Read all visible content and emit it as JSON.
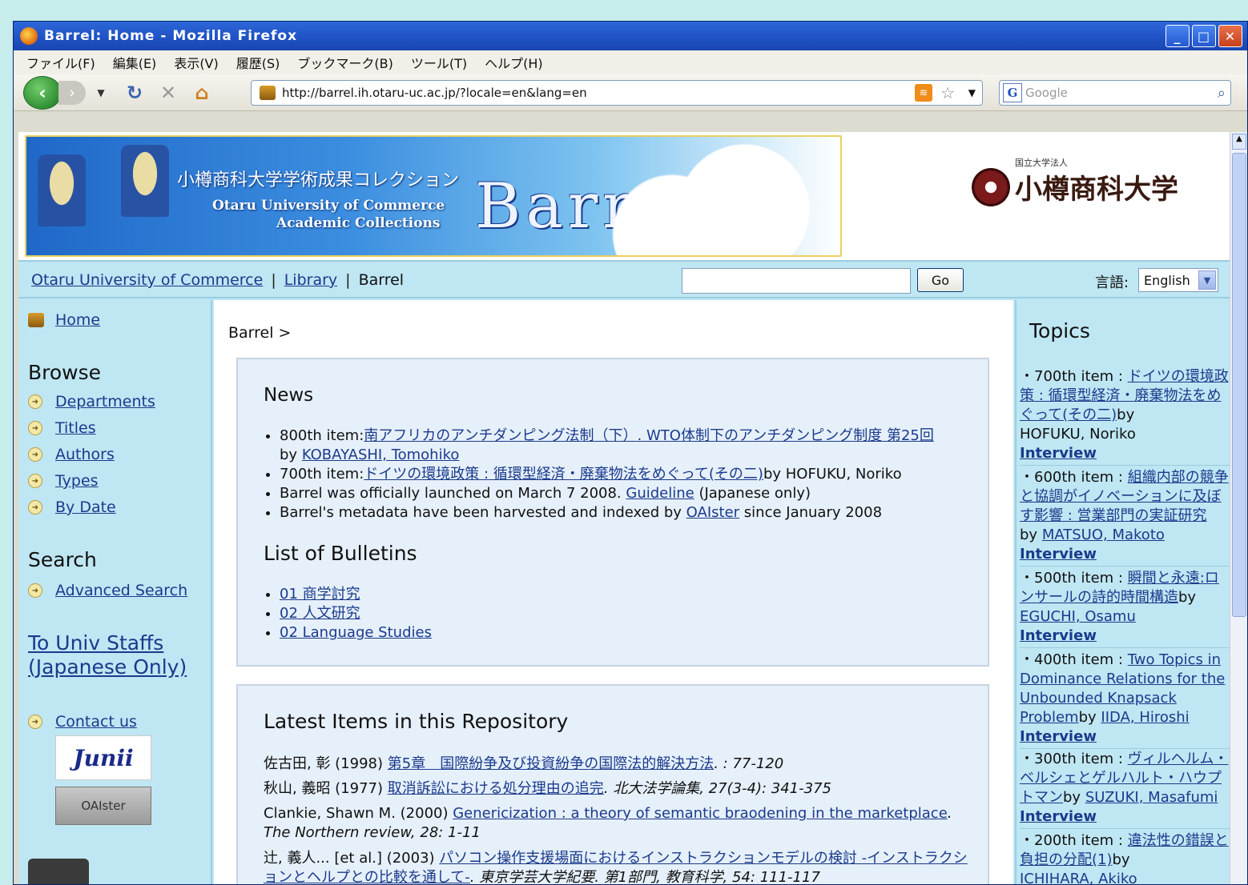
{
  "window": {
    "title": "Barrel: Home - Mozilla Firefox"
  },
  "menu": [
    "ファイル(F)",
    "編集(E)",
    "表示(V)",
    "履歴(S)",
    "ブックマーク(B)",
    "ツール(T)",
    "ヘルプ(H)"
  ],
  "nav": {
    "url": "http://barrel.ih.otaru-uc.ac.jp/?locale=en&lang=en",
    "search_placeholder": "Google"
  },
  "banner": {
    "jp_title": "小樽商科大学学術成果コレクション",
    "en_line1": "Otaru University of Commerce",
    "en_line2": "Academic Collections",
    "logo_text": "Barrel",
    "univ_small": "国立大学法人",
    "univ_name": "小樽商科大学"
  },
  "topbar": {
    "link1": "Otaru University of Commerce",
    "link2": "Library",
    "current": "Barrel",
    "sep": "|",
    "go_label": "Go",
    "lang_label": "言語:",
    "lang_value": "English"
  },
  "left": {
    "home": "Home",
    "browse_heading": "Browse",
    "browse_items": [
      "Departments",
      "Titles",
      "Authors",
      "Types",
      "By Date"
    ],
    "search_heading": "Search",
    "advanced_search": "Advanced Search",
    "staff_link_line1": "To Univ Staffs",
    "staff_link_line2": "(Japanese Only)",
    "contact": "Contact us",
    "junii_label": "Junii",
    "oaister_label": "OAIster"
  },
  "center": {
    "breadcrumb": "Barrel >",
    "news_heading": "News",
    "news": [
      {
        "prefix": "800th item:",
        "link": "南アフリカのアンチダンピング法制（下）. WTO体制下のアンチダンピング制度 第25回",
        "by": "by ",
        "author": "KOBAYASHI, Tomohiko"
      },
      {
        "prefix": "700th item:",
        "link": "ドイツの環境政策 : 循環型経済・廃棄物法をめぐって(その二)",
        "suffix": "by HOFUKU, Noriko"
      },
      {
        "prefix": "Barrel was officially launched on March 7 2008. ",
        "link": "Guideline",
        "suffix": " (Japanese only)"
      },
      {
        "prefix": "Barrel's metadata have been harvested and indexed by ",
        "link": "OAIster",
        "suffix": " since January 2008"
      }
    ],
    "bulletins_heading": "List of Bulletins",
    "bulletins": [
      "01 商学討究",
      "02 人文研究",
      "02 Language Studies"
    ],
    "latest_heading": "Latest Items in this Repository",
    "latest": [
      {
        "author": "佐古田, 彰 (1998) ",
        "title": "第5章　国際紛争及び投資紛争の国際法的解決方法",
        "source": ". : 77-120"
      },
      {
        "author": "秋山, 義昭 (1977) ",
        "title": "取消訴訟における処分理由の追完",
        "source": ". 北大法学論集, 27(3-4): 341-375"
      },
      {
        "author": "Clankie, Shawn M. (2000) ",
        "title": "Genericization : a theory of semantic braodening in the marketplace",
        "source": ". The Northern review, 28: 1-11"
      },
      {
        "author": "辻, 義人... [et al.] (2003) ",
        "title": "パソコン操作支援場面におけるインストラクションモデルの検討 -インストラクションとヘルプとの比較を通して-",
        "source": ". 東京学芸大学紀要. 第1部門, 教育科学, 54: 111-117"
      }
    ]
  },
  "right": {
    "heading": "Topics",
    "topics": [
      {
        "prefix": "・700th item : ",
        "link": "ドイツの環境政策 : 循環型経済・廃棄物法をめぐって(その二)",
        "by": "by",
        "author": "HOFUKU, Noriko",
        "author_link": false,
        "interview": "Interview"
      },
      {
        "prefix": "・600th item : ",
        "link": "組織内部の競争と協調がイノベーションに及ぼす影響 : 営業部門の実証研究",
        "by": "by ",
        "author": "MATSUO, Makoto",
        "author_link": true,
        "interview": "Interview"
      },
      {
        "prefix": "・500th item : ",
        "link": "瞬間と永遠:ロンサールの詩的時間構造",
        "by": "by",
        "author": "EGUCHI, Osamu",
        "author_link": true,
        "interview": "Interview"
      },
      {
        "prefix": "・400th item : ",
        "link": "Two Topics in Dominance Relations for the Unbounded Knapsack Problem",
        "by": "by ",
        "author": "IIDA, Hiroshi",
        "author_link": true,
        "interview": "Interview"
      },
      {
        "prefix": "・300th item : ",
        "link": "ヴィルヘルム・ベルシェとゲルハルト・ハウプトマン",
        "by": "by ",
        "author": "SUZUKI, Masafumi",
        "author_link": true,
        "interview": "Interview"
      },
      {
        "prefix": "・200th item : ",
        "link": "違法性の錯誤と負担の分配(1)",
        "by": "by",
        "author": "ICHIHARA, Akiko",
        "author_link": true,
        "interview": ""
      }
    ]
  }
}
